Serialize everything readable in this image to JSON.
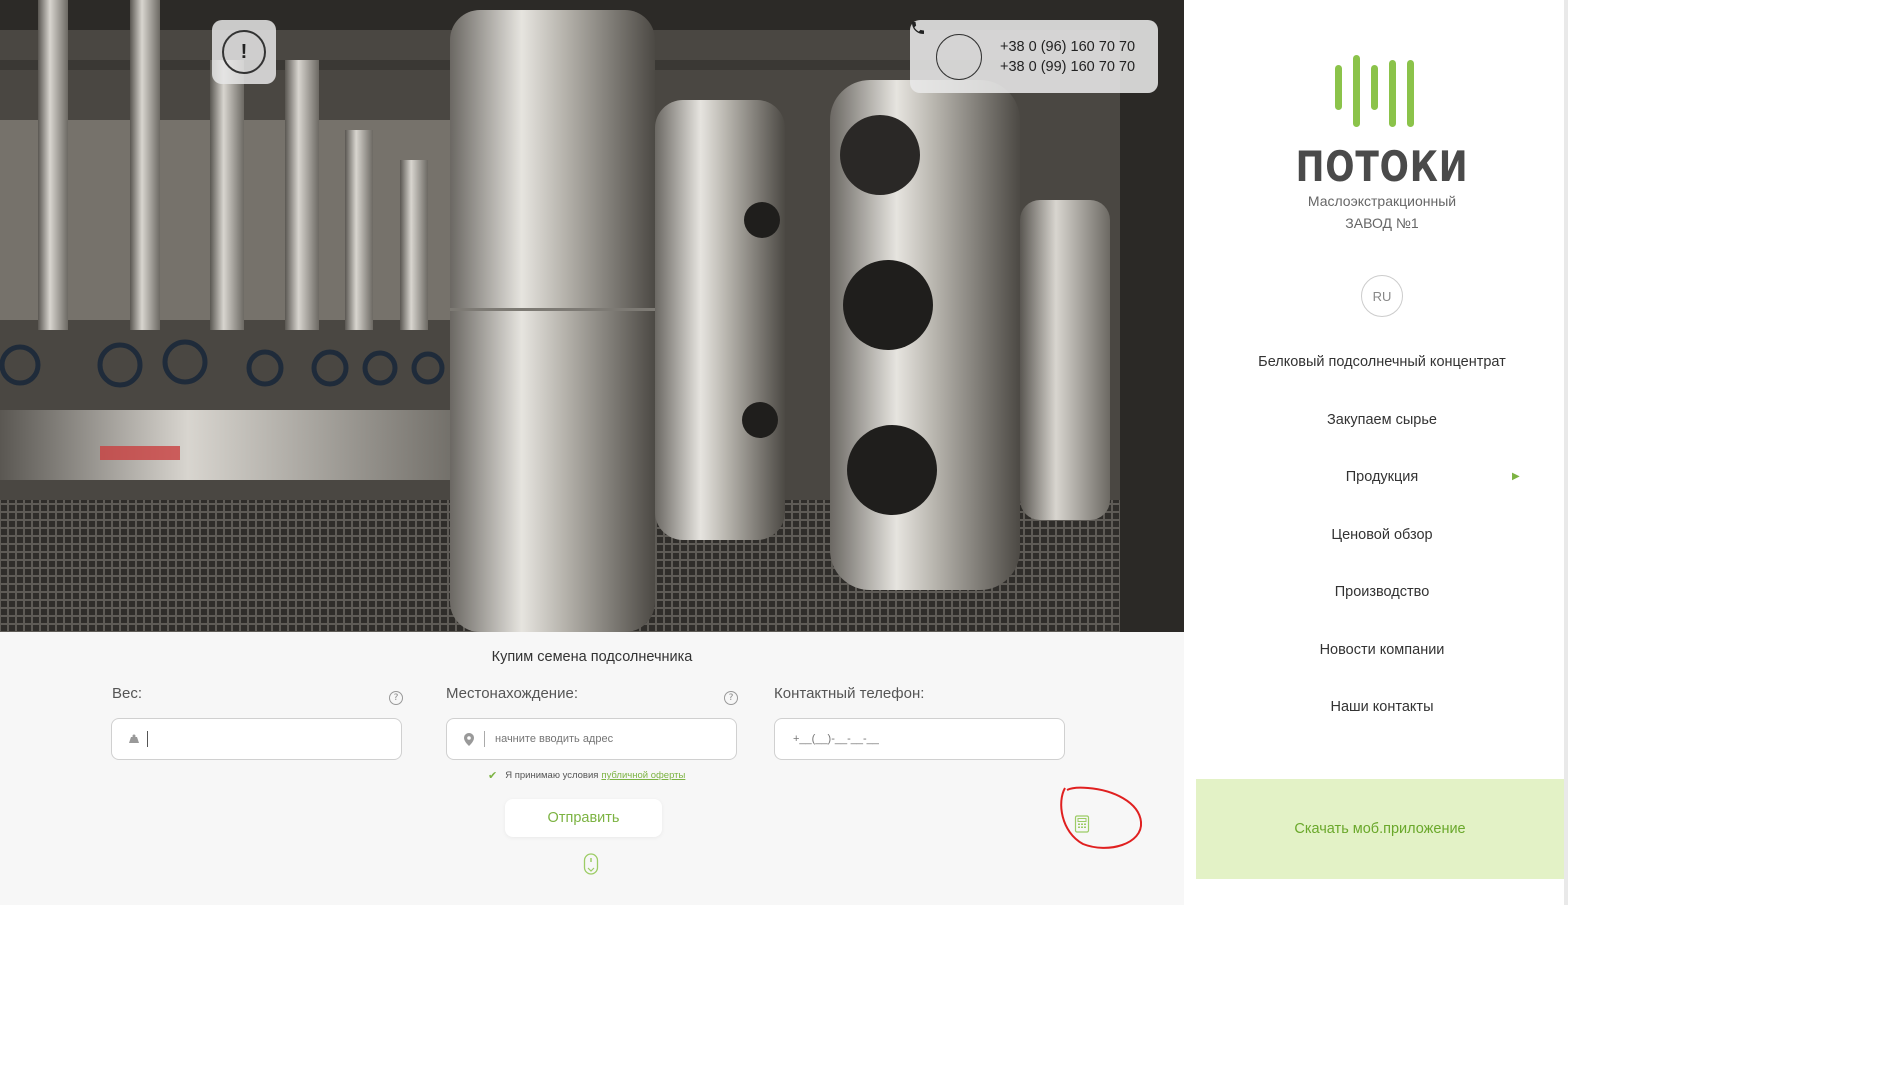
{
  "header": {
    "phones": [
      "+38 0 (96) 160 70 70",
      "+38 0 (99) 160 70 70"
    ],
    "info_icon": "exclamation-icon",
    "phone_icon": "phone-icon"
  },
  "form": {
    "title": "Купим семена подсолнечника",
    "weight": {
      "label": "Вес:",
      "placeholder": "",
      "icon": "weight-icon"
    },
    "location": {
      "label": "Местонахождение:",
      "placeholder": "начните вводить адрес",
      "icon": "map-pin-icon"
    },
    "phone": {
      "label": "Контактный телефон:",
      "placeholder": "+__(__)-__-__-__"
    },
    "help_glyph": "?",
    "consent": {
      "text": "Я принимаю условия",
      "link": "публичной оферты",
      "checked": true
    },
    "submit_label": "Отправить"
  },
  "sidebar": {
    "logo_text": "ПОТОКИ",
    "logo_sub_line1": "Маслоэкстракционный",
    "logo_sub_line2": "ЗАВОД №1",
    "lang": "RU",
    "nav": [
      {
        "label": "Белковый подсолнечный концентрат"
      },
      {
        "label": "Закупаем сырье"
      },
      {
        "label": "Продукция",
        "has_submenu": true
      },
      {
        "label": "Ценовой обзор"
      },
      {
        "label": "Производство"
      },
      {
        "label": "Новости компании"
      },
      {
        "label": "Наши контакты"
      }
    ],
    "download_label": "Скачать моб.приложение"
  },
  "colors": {
    "accent": "#7cb342",
    "download_bg": "#e3f2c6",
    "annotation": "#e02020"
  }
}
